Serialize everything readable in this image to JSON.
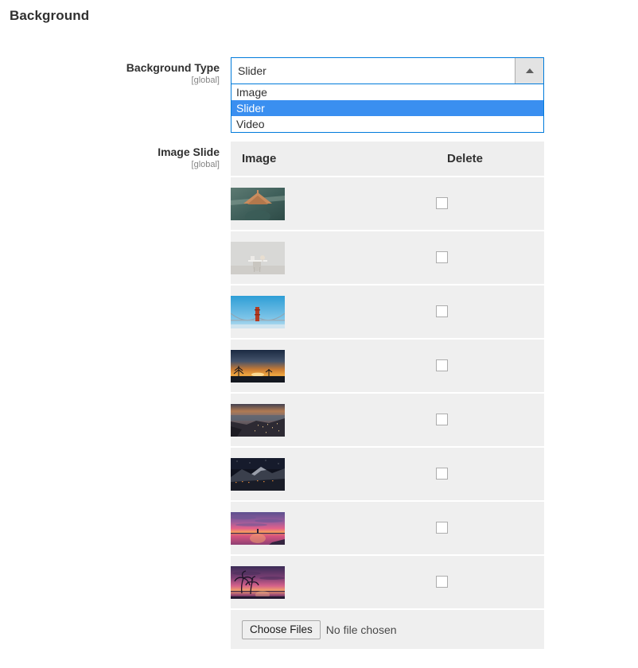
{
  "section": {
    "title": "Background"
  },
  "fields": {
    "background_type": {
      "label": "Background Type",
      "scope": "[global]",
      "value": "Slider",
      "dropdown_open": true,
      "arrow_icon": "caret-up-icon",
      "options": [
        {
          "label": "Image",
          "selected": false
        },
        {
          "label": "Slider",
          "selected": true
        },
        {
          "label": "Video",
          "selected": false
        }
      ]
    },
    "image_slide": {
      "label": "Image Slide",
      "scope": "[global]",
      "columns": [
        "Image",
        "Delete"
      ],
      "rows": [
        {
          "image_name": "wooden-hangers-on-teal-shirt-thumbnail",
          "delete_checked": false
        },
        {
          "image_name": "minimal-white-interior-desk-thumbnail",
          "delete_checked": false
        },
        {
          "image_name": "golden-gate-bridge-blue-sky-thumbnail",
          "delete_checked": false
        },
        {
          "image_name": "sunset-over-dark-field-trees-thumbnail",
          "delete_checked": false
        },
        {
          "image_name": "coastal-city-dusk-thumbnail",
          "delete_checked": false
        },
        {
          "image_name": "snowy-mountain-at-night-thumbnail",
          "delete_checked": false
        },
        {
          "image_name": "pink-purple-sunset-over-water-thumbnail",
          "delete_checked": false
        },
        {
          "image_name": "palm-trees-tropical-sunset-thumbnail",
          "delete_checked": false
        }
      ],
      "upload": {
        "button_label": "Choose Files",
        "status_text": "No file chosen"
      }
    }
  },
  "colors": {
    "accent_border": "#007bdb",
    "option_highlight": "#3a8ff0",
    "row_background": "#efefef",
    "header_background": "#eeeeee",
    "page_background": "#ffffff",
    "label_text": "#303030",
    "scope_text": "#858585"
  }
}
